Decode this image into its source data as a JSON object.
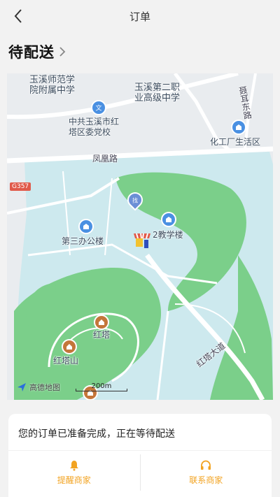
{
  "nav": {
    "title": "订单",
    "back_icon": "back-chevron-icon"
  },
  "order": {
    "status": "待配送"
  },
  "map": {
    "labels": {
      "school1": "玉溪师范学\n院附属中学",
      "school2": "玉溪第二职\n业高级中学",
      "road_vertical": "聂耳东路",
      "party_school": "中共玉溪市红\n塔区委党校",
      "chem_area": "化工厂生活区",
      "phoenix_road": "凤凰路",
      "highway": "G357",
      "office3": "第三办公楼",
      "teach2": "2教学楼",
      "hongta": "红塔",
      "hongta_mountain": "红塔山",
      "hongta_avenue": "红塔大道"
    },
    "brand": "高德地图",
    "scale": "200m",
    "colors": {
      "water": "#cde9ee",
      "green": "#7bcf8a",
      "road": "#ffffff",
      "land": "#e9ecef"
    }
  },
  "card": {
    "message": "您的订单已准备完成，正在等待配送",
    "remind_label": "提醒商家",
    "contact_label": "联系商家",
    "accent": "#f2a321"
  }
}
